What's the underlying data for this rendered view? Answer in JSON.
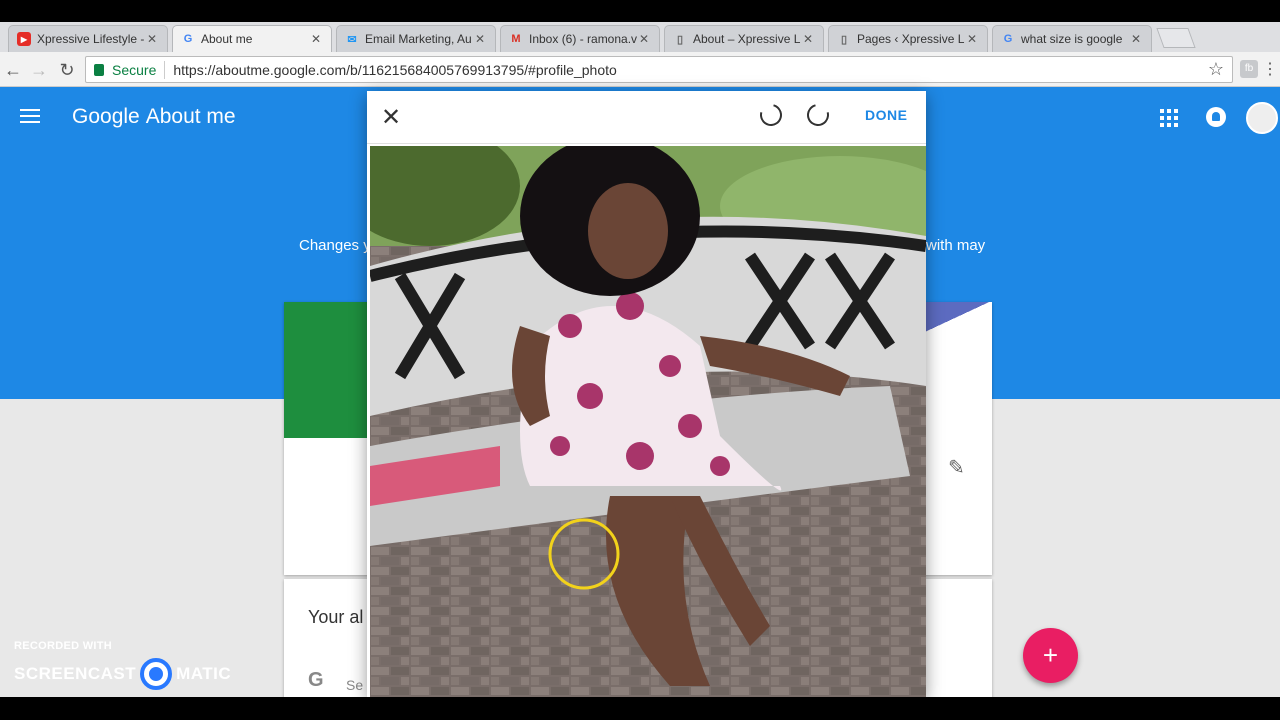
{
  "browser": {
    "tabs": [
      {
        "title": "Xpressive Lifestyle -",
        "icon": "youtube-icon",
        "active": false
      },
      {
        "title": "About me",
        "icon": "google-icon",
        "active": true
      },
      {
        "title": "Email Marketing, Au",
        "icon": "mail-icon",
        "active": false
      },
      {
        "title": "Inbox (6) - ramona.v",
        "icon": "gmail-icon",
        "active": false
      },
      {
        "title": "About – Xpressive Li",
        "icon": "page-icon",
        "active": false
      },
      {
        "title": "Pages ‹ Xpressive Lif",
        "icon": "page-icon",
        "active": false
      },
      {
        "title": "what size is google",
        "icon": "google-icon",
        "active": false
      }
    ],
    "secure_label": "Secure",
    "url": "https://aboutme.google.com/b/116215684005769913795/#profile_photo"
  },
  "app": {
    "brand_google": "Google",
    "brand_product": "About me",
    "changes_text_left": "Changes y",
    "changes_text_right": "with may",
    "card_title": "Your al",
    "search_text": "Se"
  },
  "dialog": {
    "close_label": "✕",
    "done_label": "DONE"
  },
  "fab_label": "+",
  "watermark": {
    "line1": "RECORDED WITH",
    "line2_left": "SCREENCAST",
    "line2_right": "MATIC"
  },
  "colors": {
    "header_blue": "#1e88e5",
    "fab_pink": "#e91e63",
    "done_blue": "#1e88e5",
    "secure_green": "#0b8043"
  }
}
